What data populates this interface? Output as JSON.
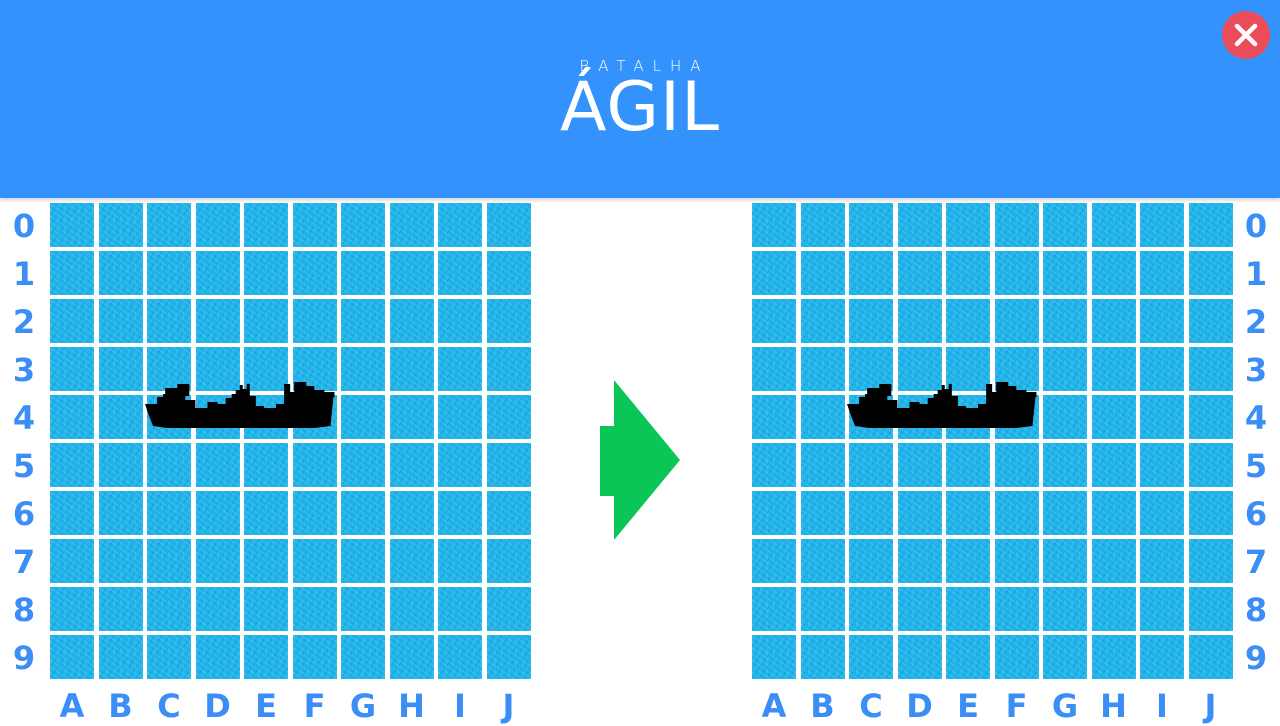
{
  "header": {
    "logo_small": "BATALHA",
    "logo_main": "ÁGIL",
    "close_icon": "close-icon"
  },
  "rows": [
    "0",
    "1",
    "2",
    "3",
    "4",
    "5",
    "6",
    "7",
    "8",
    "9"
  ],
  "columns": [
    "A",
    "B",
    "C",
    "D",
    "E",
    "F",
    "G",
    "H",
    "I",
    "J"
  ],
  "boards": [
    {
      "id": "left",
      "ship": {
        "row": 4,
        "start_column": "C",
        "end_column": "F",
        "length": 4
      }
    },
    {
      "id": "right",
      "ship": {
        "row": 4,
        "start_column": "C",
        "end_column": "F",
        "length": 4
      }
    }
  ],
  "arrow_icon": "green-arrow-right-icon",
  "colors": {
    "header": "#3492fd",
    "water": "#1cb4ea",
    "labels": "#3a8ef5",
    "arrow": "#09c657",
    "close_button": "#ea4c59",
    "ship": "#000000"
  }
}
